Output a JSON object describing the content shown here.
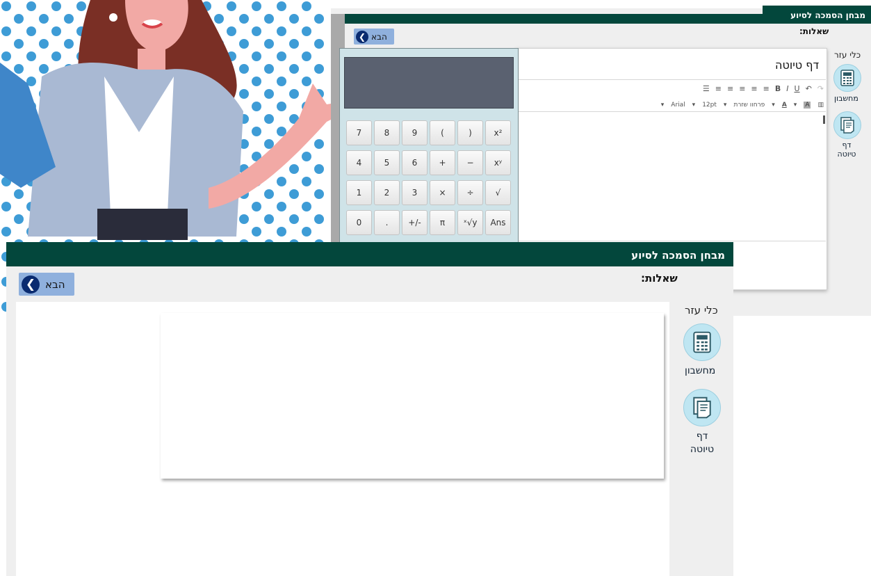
{
  "colors": {
    "header_green": "#03473c",
    "next_button_bg": "#8fb0dd",
    "chevron_navy": "#0a2b70",
    "tool_circle": "#bfe6f2"
  },
  "back_window": {
    "title": "מבחן הסמכה לסיוע",
    "questions_label": "שאלות:",
    "next_label": "הבא",
    "tools_label": "כלי עזר",
    "calculator_label": "מחשבון",
    "draft_label": "דף טיוטה",
    "draft_editor": {
      "title": "דף טיוטה",
      "toolbar_row1": [
        "B",
        "I",
        "U"
      ],
      "font_size": "12pt",
      "font_name": "Arial",
      "font_style": "פרחוו שזרת",
      "text_color_label": "A"
    }
  },
  "calculator": {
    "keys": [
      [
        "7",
        "8",
        "9",
        "(",
        ")",
        "x²"
      ],
      [
        "4",
        "5",
        "6",
        "+",
        "−",
        "xʸ"
      ],
      [
        "1",
        "2",
        "3",
        "×",
        "÷",
        "√"
      ],
      [
        "0",
        ".",
        "+/-",
        "π",
        "ˣ√y",
        "Ans"
      ]
    ]
  },
  "front_window": {
    "title": "מבחן הסמכה לסיוע",
    "questions_label": "שאלות:",
    "next_label": "הבא",
    "tools_label": "כלי עזר",
    "calculator_label": "מחשבון",
    "draft_label": "דף טיוטה"
  }
}
